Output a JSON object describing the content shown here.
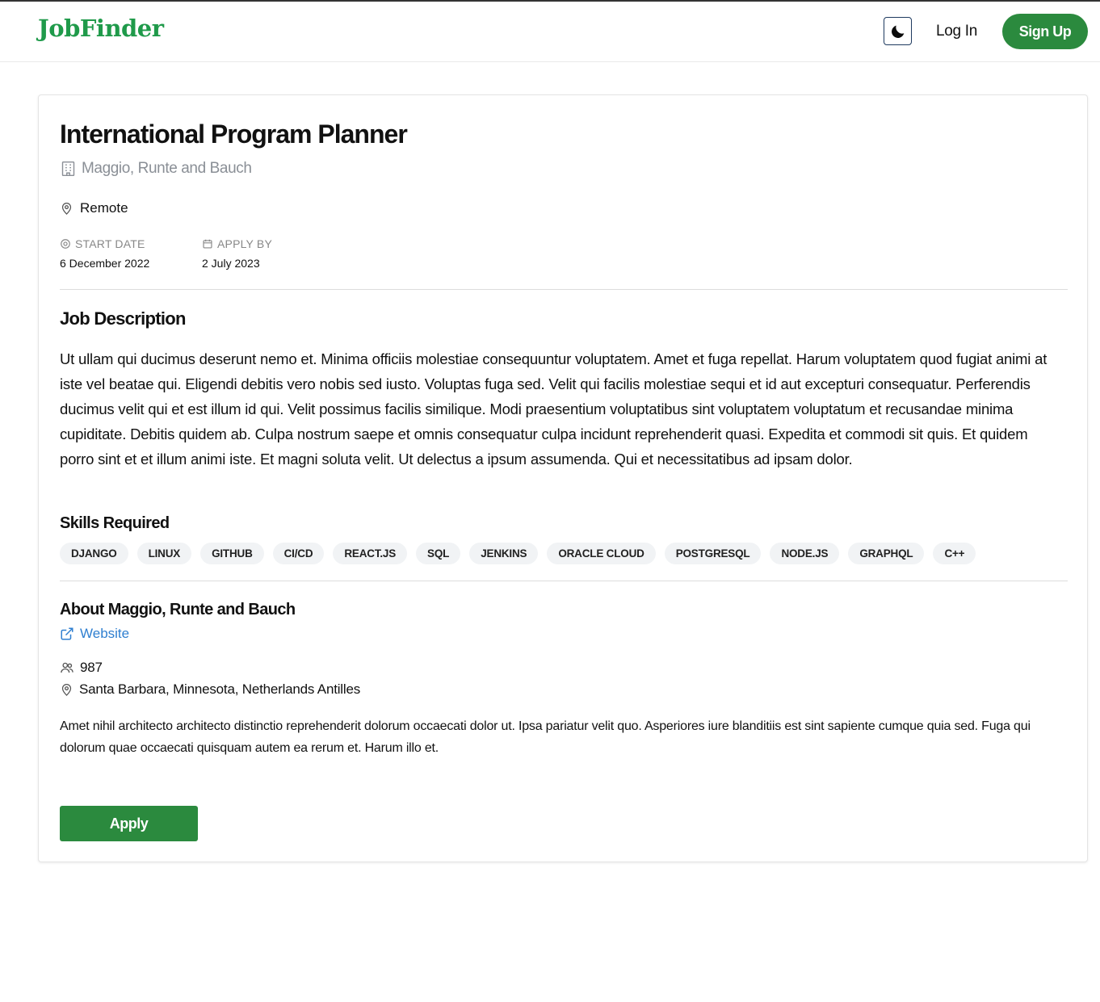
{
  "nav": {
    "logo": "JobFinder",
    "login_label": "Log In",
    "signup_label": "Sign Up",
    "theme_icon": "moon-icon"
  },
  "job": {
    "title": "International Program Planner",
    "company": "Maggio, Runte and Bauch",
    "location": "Remote",
    "start_date_label": "START DATE",
    "start_date": "6 December 2022",
    "apply_by_label": "APPLY BY",
    "apply_by": "2 July 2023"
  },
  "description": {
    "title": "Job Description",
    "text": "Ut ullam qui ducimus deserunt nemo et. Minima officiis molestiae consequuntur voluptatem. Amet et fuga repellat. Harum voluptatem quod fugiat animi at iste vel beatae qui. Eligendi debitis vero nobis sed iusto. Voluptas fuga sed. Velit qui facilis molestiae sequi et id aut excepturi consequatur. Perferendis ducimus velit qui et est illum id qui. Velit possimus facilis similique. Modi praesentium voluptatibus sint voluptatem voluptatum et recusandae minima cupiditate. Debitis quidem ab. Culpa nostrum saepe et omnis consequatur culpa incidunt reprehenderit quasi. Expedita et commodi sit quis. Et quidem porro sint et et illum animi iste. Et magni soluta velit. Ut delectus a ipsum assumenda. Qui et necessitatibus ad ipsam dolor."
  },
  "skills": {
    "title": "Skills Required",
    "items": [
      "DJANGO",
      "LINUX",
      "GITHUB",
      "CI/CD",
      "REACT.JS",
      "SQL",
      "JENKINS",
      "ORACLE CLOUD",
      "POSTGRESQL",
      "NODE.JS",
      "GRAPHQL",
      "C++"
    ]
  },
  "about": {
    "title": "About Maggio, Runte and Bauch",
    "website_label": "Website",
    "employees": "987",
    "headquarters": "Santa Barbara, Minnesota, Netherlands Antilles",
    "text": "Amet nihil architecto architecto distinctio reprehenderit dolorum occaecati dolor ut. Ipsa pariatur velit quo. Asperiores iure blanditiis est sint sapiente cumque quia sed. Fuga qui dolorum quae occaecati quisquam autem ea rerum et. Harum illo et."
  },
  "actions": {
    "apply_label": "Apply"
  },
  "colors": {
    "brand_green": "#2b8a3e",
    "logo_green": "#1f9a4a",
    "link_blue": "#2f7fd0",
    "muted_gray": "#8a8f96"
  }
}
